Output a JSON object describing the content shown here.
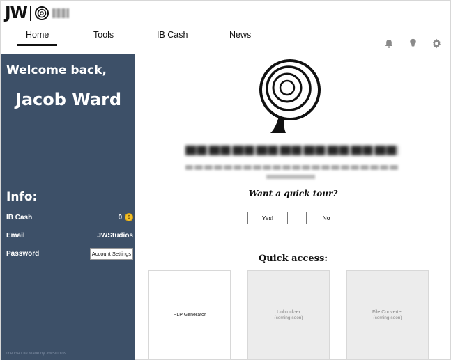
{
  "brand": {
    "logo_text": "JW"
  },
  "nav": {
    "tabs": [
      {
        "label": "Home"
      },
      {
        "label": "Tools"
      },
      {
        "label": "IB Cash"
      },
      {
        "label": "News"
      }
    ]
  },
  "header_icons": [
    "bell-icon",
    "lightbulb-icon",
    "gear-icon"
  ],
  "sidebar": {
    "welcome": "Welcome back,",
    "user_name": "Jacob Ward",
    "info_title": "Info:",
    "info": {
      "ib_cash_label": "IB Cash",
      "ib_cash_value": "0",
      "email_label": "Email",
      "email_value": "JWStudios",
      "password_label": "Password",
      "account_settings_button": "Account Settings"
    },
    "footer": "The GA Life   Made by JWStudios"
  },
  "main": {
    "tour_question": "Want a quick tour?",
    "yes_button": "Yes!",
    "no_button": "No",
    "quick_access_title": "Quick access:",
    "cards": [
      {
        "title": "PLP Generator",
        "subtitle": ""
      },
      {
        "title": "Unblock-er",
        "subtitle": "(coming soon)"
      },
      {
        "title": "File Converter",
        "subtitle": "(coming soon)"
      }
    ]
  },
  "colors": {
    "sidebar_bg": "#3d5068",
    "coin": "#f2c029",
    "card_disabled_bg": "#ececec"
  }
}
